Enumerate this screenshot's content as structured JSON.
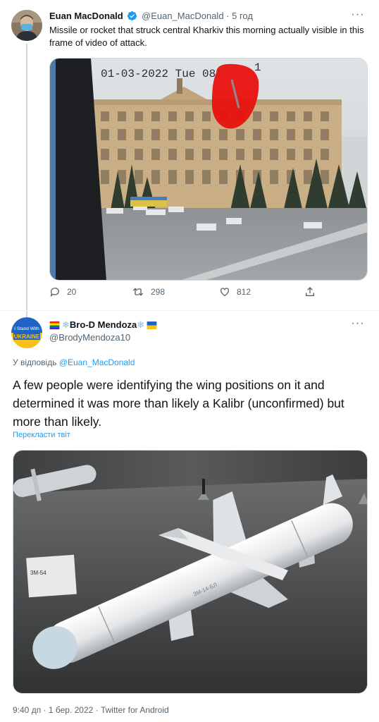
{
  "tweet1": {
    "author_name": "Euan MacDonald",
    "handle": "@Euan_MacDonald",
    "separator": " · ",
    "time": "5 год",
    "text": "Missile or rocket that struck central Kharkiv this morning actually visible in this frame of video of attack.",
    "video_timestamp": "01-03-2022 Tue 08:",
    "video_timestamp_tail": "1",
    "more": "···",
    "replies": "20",
    "retweets": "298",
    "likes": "812"
  },
  "tweet2": {
    "author_name": "Bro-D Mendoza",
    "snowflake": "❄",
    "handle": "@BrodyMendoza10",
    "avatar_text_top": "I Stand With",
    "avatar_text_bottom": "UKRAINE",
    "replying_prefix": "У відповідь ",
    "replying_to": "@Euan_MacDonald",
    "text": "A few people were identifying the wing positions on it and determined it was more than likely a Kalibr (unconfirmed) but more than likely.",
    "translate": "Перекласти твіт",
    "missile_marking": "ЗМ-14-БЛ",
    "plaque_text": "3M-54",
    "meta": "9:40 дп · 1 бер. 2022 · Twitter for Android",
    "more": "···"
  },
  "colors": {
    "accent": "#1d9bf0",
    "text_secondary": "#536471",
    "divider": "#eff3f4",
    "annotation_red": "#e8110d"
  }
}
